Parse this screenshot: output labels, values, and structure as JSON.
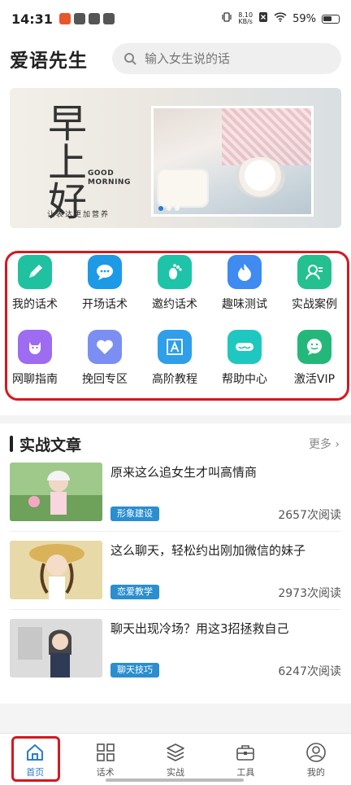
{
  "status_bar": {
    "time": "14:31",
    "net_speed": "8.10",
    "net_unit": "KB/s",
    "battery": "59%"
  },
  "header": {
    "app_title": "爱语先生",
    "search_placeholder": "输入女生说的话"
  },
  "banner": {
    "greeting_chars": "早上好",
    "english": [
      "GOOD",
      "MORNING"
    ],
    "subtitle": "让表达更加营养"
  },
  "grid": {
    "items": [
      {
        "label": "我的话术",
        "icon": "pencil-icon",
        "color": "#1fc1a0"
      },
      {
        "label": "开场话术",
        "icon": "chat-bubble-icon",
        "color": "#1d9ae6"
      },
      {
        "label": "邀约话术",
        "icon": "footprint-icon",
        "color": "#1ec3a8"
      },
      {
        "label": "趣味测试",
        "icon": "flame-icon",
        "color": "#3f8bf0"
      },
      {
        "label": "实战案例",
        "icon": "user-card-icon",
        "color": "#24c08f"
      },
      {
        "label": "网聊指南",
        "icon": "cat-icon",
        "color": "#9d6cf1"
      },
      {
        "label": "挽回专区",
        "icon": "heart-icon",
        "color": "#7b8ff3"
      },
      {
        "label": "高阶教程",
        "icon": "letter-a-icon",
        "color": "#2e9fe8"
      },
      {
        "label": "帮助中心",
        "icon": "vr-goggles-icon",
        "color": "#1ec8c0"
      },
      {
        "label": "激活VIP",
        "icon": "smile-chat-icon",
        "color": "#23b87a"
      }
    ]
  },
  "articles": {
    "section_title": "实战文章",
    "more_label": "更多",
    "items": [
      {
        "title": "原来这么追女生才叫高情商",
        "tag": "形象建设",
        "reads": "2657次阅读"
      },
      {
        "title": "这么聊天，轻松约出刚加微信的妹子",
        "tag": "恋爱教学",
        "reads": "2973次阅读"
      },
      {
        "title": "聊天出现冷场？用这3招拯救自己",
        "tag": "聊天技巧",
        "reads": "6247次阅读"
      }
    ]
  },
  "bottom_nav": {
    "items": [
      {
        "label": "首页",
        "icon": "home-icon",
        "active": true
      },
      {
        "label": "话术",
        "icon": "grid-icon",
        "active": false
      },
      {
        "label": "实战",
        "icon": "layers-icon",
        "active": false
      },
      {
        "label": "工具",
        "icon": "toolbox-icon",
        "active": false
      },
      {
        "label": "我的",
        "icon": "profile-icon",
        "active": false
      }
    ],
    "active_color": "#2a7ccc"
  }
}
